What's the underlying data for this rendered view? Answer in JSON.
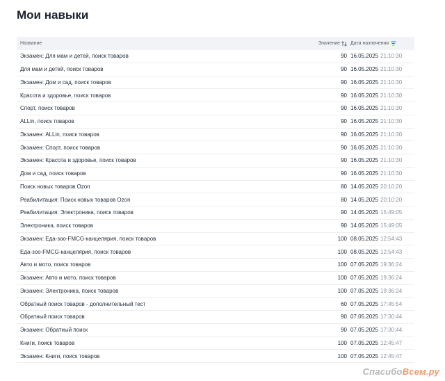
{
  "page": {
    "title": "Мои навыки"
  },
  "table": {
    "columns": {
      "name": "Название",
      "value": "Значение",
      "date": "Дата назначения"
    },
    "rows": [
      {
        "name": "Экзамен: Для мам и детей, поиск товаров",
        "value": "90",
        "date": "16.05.2025",
        "time": "21:10:30"
      },
      {
        "name": "Для мам и детей, поиск товаров",
        "value": "90",
        "date": "16.05.2025",
        "time": "21:10:30"
      },
      {
        "name": "Экзамен: Дом и сад, поиск товаров",
        "value": "90",
        "date": "16.05.2025",
        "time": "21:10:30"
      },
      {
        "name": "Красота и здоровье, поиск товаров",
        "value": "90",
        "date": "16.05.2025",
        "time": "21:10:30"
      },
      {
        "name": "Спорт, поиск товаров",
        "value": "90",
        "date": "16.05.2025",
        "time": "21:10:30"
      },
      {
        "name": "ALLin, поиск товаров",
        "value": "90",
        "date": "16.05.2025",
        "time": "21:10:30"
      },
      {
        "name": "Экзамен: ALLin, поиск товаров",
        "value": "90",
        "date": "16.05.2025",
        "time": "21:10:30"
      },
      {
        "name": "Экзамен: Спорт, поиск товаров",
        "value": "90",
        "date": "16.05.2025",
        "time": "21:10:30"
      },
      {
        "name": "Экзамен: Красота и здоровье, поиск товаров",
        "value": "90",
        "date": "16.05.2025",
        "time": "21:10:30"
      },
      {
        "name": "Дом и сад, поиск товаров",
        "value": "90",
        "date": "16.05.2025",
        "time": "21:10:30"
      },
      {
        "name": "Поиск новых товаров Ozon",
        "value": "80",
        "date": "14.05.2025",
        "time": "20:10:20"
      },
      {
        "name": "Реабилитация: Поиск новых товаров Ozon",
        "value": "80",
        "date": "14.05.2025",
        "time": "20:10:20"
      },
      {
        "name": "Реабилитация: Электроника, поиск товаров",
        "value": "90",
        "date": "14.05.2025",
        "time": "15:49:05"
      },
      {
        "name": "Электроника, поиск товаров",
        "value": "90",
        "date": "14.05.2025",
        "time": "15:49:05"
      },
      {
        "name": "Экзамен: Еда-зоо-FMCG-канцелярия, поиск товаров",
        "value": "100",
        "date": "08.05.2025",
        "time": "12:54:43"
      },
      {
        "name": "Еда-зоо-FMCG-канцелярия, поиск товаров",
        "value": "100",
        "date": "08.05.2025",
        "time": "12:54:43"
      },
      {
        "name": "Авто и мото, поиск товаров",
        "value": "100",
        "date": "07.05.2025",
        "time": "19:36:24"
      },
      {
        "name": "Экзамен: Авто и мото, поиск товаров",
        "value": "100",
        "date": "07.05.2025",
        "time": "19:36:24"
      },
      {
        "name": "Экзамен: Электроника, поиск товаров",
        "value": "100",
        "date": "07.05.2025",
        "time": "19:36:24"
      },
      {
        "name": "Обратный поиск товаров - дополнительный тест",
        "value": "60",
        "date": "07.05.2025",
        "time": "17:45:54"
      },
      {
        "name": "Обратный поиск товаров",
        "value": "90",
        "date": "07.05.2025",
        "time": "17:30:44"
      },
      {
        "name": "Экзамен: Обратный поиск",
        "value": "90",
        "date": "07.05.2025",
        "time": "17:30:44"
      },
      {
        "name": "Книги, поиск товаров",
        "value": "100",
        "date": "07.05.2025",
        "time": "12:45:47"
      },
      {
        "name": "Экзамен: Книги, поиск товаров",
        "value": "100",
        "date": "07.05.2025",
        "time": "12:45:47"
      }
    ]
  },
  "watermark": {
    "text_a": "Спасибо",
    "text_b": "Всем.ру"
  },
  "colors": {
    "header_bg": "#f1f3f6",
    "sort_icon": "#2f6bff",
    "muted_time": "#8a929c"
  }
}
